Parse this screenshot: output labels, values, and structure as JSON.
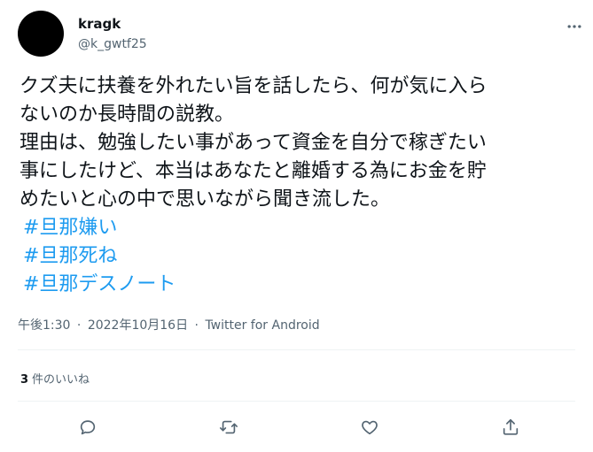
{
  "author": {
    "display_name": "kragk",
    "handle": "@k_gwtf25"
  },
  "more_icon": "more-horizontal-icon",
  "tweet": {
    "lines": [
      "クズ夫に扶養を外れたい旨を話したら、何が気に入ら",
      "ないのか長時間の説教。",
      "理由は、勉強したい事があって資金を自分で稼ぎたい",
      "事にしたけど、本当はあなたと離婚する為にお金を貯",
      "めたいと心の中で思いながら聞き流した。"
    ],
    "hashtags": [
      "#旦那嫌い",
      "#旦那死ね",
      "#旦那デスノート"
    ]
  },
  "meta": {
    "time": "午後1:30",
    "separator": "·",
    "date": "2022年10月16日",
    "source": "Twitter for Android"
  },
  "likes": {
    "count": "3",
    "label": "件のいいね"
  },
  "actions": {
    "reply_icon": "reply-icon",
    "retweet_icon": "retweet-icon",
    "like_icon": "like-icon",
    "share_icon": "share-icon"
  },
  "colors": {
    "text": "#0f1419",
    "secondary": "#536471",
    "link": "#1d9bf0",
    "divider": "#eff3f4",
    "avatar": "#000000"
  }
}
